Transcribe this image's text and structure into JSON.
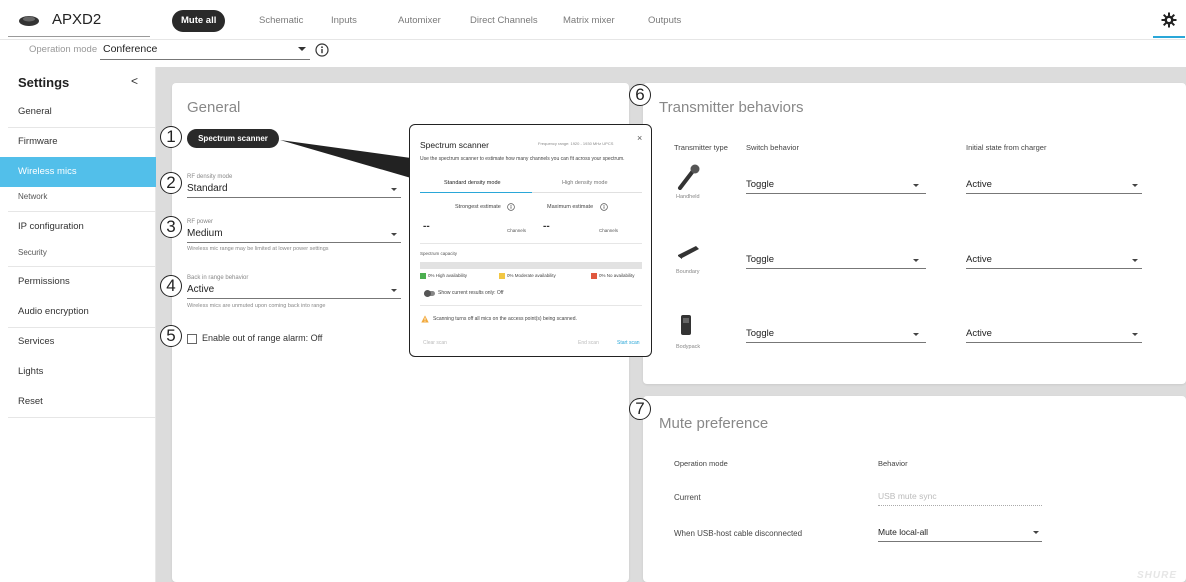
{
  "device": {
    "name": "APXD2"
  },
  "tabs": [
    {
      "label": "Mute all",
      "active": true
    },
    {
      "label": "Schematic"
    },
    {
      "label": "Inputs"
    },
    {
      "label": "Automixer"
    },
    {
      "label": "Direct Channels"
    },
    {
      "label": "Matrix mixer"
    },
    {
      "label": "Outputs"
    }
  ],
  "operation_mode": {
    "label": "Operation mode",
    "value": "Conference"
  },
  "sidebar": {
    "title": "Settings",
    "collapse_glyph": "<",
    "items": [
      {
        "label": "General"
      },
      {
        "label": "Firmware"
      },
      {
        "label": "Wireless mics",
        "active": true
      },
      {
        "label": "Network",
        "section": true
      },
      {
        "label": "IP configuration"
      },
      {
        "label": "Security",
        "section": true
      },
      {
        "label": "Permissions"
      },
      {
        "label": "Audio encryption"
      },
      {
        "label": "Services"
      },
      {
        "label": "Lights"
      },
      {
        "label": "Reset"
      }
    ]
  },
  "general": {
    "title": "General",
    "spectrum_button": "Spectrum scanner",
    "rf_density": {
      "label": "RF density mode",
      "value": "Standard"
    },
    "rf_power": {
      "label": "RF power",
      "value": "Medium",
      "helper": "Wireless mic range may be limited at lower power settings"
    },
    "back_in_range": {
      "label": "Back in range behavior",
      "value": "Active",
      "helper": "Wireless mics are unmuted upon coming back into range"
    },
    "alarm": {
      "label": "Enable out of range alarm: Off",
      "checked": false
    }
  },
  "callouts": [
    "1",
    "2",
    "3",
    "4",
    "5",
    "6",
    "7"
  ],
  "spectrum_popup": {
    "title": "Spectrum scanner",
    "frequency_range": "Frequency range: 1920 - 1930 MHz UPCS",
    "close": "×",
    "description": "Use the spectrum scanner to estimate how many channels you can fit across your spectrum.",
    "tabs": [
      {
        "label": "Standard density mode",
        "active": true
      },
      {
        "label": "High density mode"
      }
    ],
    "strongest_label": "Strongest estimate",
    "maximum_label": "Maximum estimate",
    "strongest_value": "--",
    "maximum_value": "--",
    "unit": "Channels",
    "capacity_label": "Spectrum capacity",
    "legend": [
      {
        "label": "0% High availability",
        "color": "#4caf50"
      },
      {
        "label": "0% Moderate availability",
        "color": "#f2c744"
      },
      {
        "label": "0% No availability",
        "color": "#e0573e"
      }
    ],
    "toggle_label": "Show current results only: Off",
    "warning": "Scanning turns off all mics on the access point(s) being scanned.",
    "actions": {
      "clear": "Clear scan",
      "end": "End scan",
      "start": "Start scan"
    }
  },
  "transmitter": {
    "title": "Transmitter behaviors",
    "headers": {
      "type": "Transmitter type",
      "switch": "Switch behavior",
      "initial": "Initial state from charger"
    },
    "rows": [
      {
        "name": "Handheld",
        "switch": "Toggle",
        "initial": "Active"
      },
      {
        "name": "Boundary",
        "switch": "Toggle",
        "initial": "Active"
      },
      {
        "name": "Bodypack",
        "switch": "Toggle",
        "initial": "Active"
      }
    ]
  },
  "mute_preference": {
    "title": "Mute preference",
    "headers": {
      "mode": "Operation mode",
      "behavior": "Behavior"
    },
    "current": {
      "label": "Current",
      "value": "USB mute sync"
    },
    "usb_host": {
      "label": "When USB-host cable disconnected",
      "value": "Mute local-all"
    }
  },
  "brand": {
    "logo": "SHURE"
  },
  "colors": {
    "accent": "#2aa7d8",
    "sidebar_active": "#52bfea",
    "dark": "#2a2a2a"
  }
}
